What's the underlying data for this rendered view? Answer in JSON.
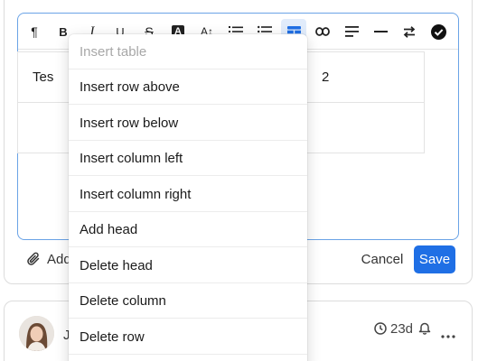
{
  "toolbar": {
    "items": [
      {
        "name": "paragraph",
        "glyph": "¶"
      },
      {
        "name": "bold",
        "glyph": "B"
      },
      {
        "name": "italic",
        "glyph": "I"
      },
      {
        "name": "underline",
        "glyph": "U"
      },
      {
        "name": "strikethrough",
        "glyph": "S"
      },
      {
        "name": "text-color",
        "glyph": "A"
      },
      {
        "name": "font-size",
        "glyph": "A↕"
      }
    ]
  },
  "table": {
    "rows": [
      [
        "Tes",
        "2"
      ],
      [
        "",
        ""
      ]
    ]
  },
  "menu": {
    "header": "Insert table",
    "items": [
      "Insert row above",
      "Insert row below",
      "Insert column left",
      "Insert column right",
      "Add head",
      "Delete head",
      "Delete column",
      "Delete row"
    ]
  },
  "footer": {
    "attach_label": "Add",
    "cancel_label": "Cancel",
    "save_label": "Save"
  },
  "comment": {
    "author_initial": "J",
    "time": "23d"
  },
  "colors": {
    "accent": "#1f6fe5",
    "active_tool_bg": "#e1ecfb",
    "editor_border": "#6aa3e6"
  }
}
